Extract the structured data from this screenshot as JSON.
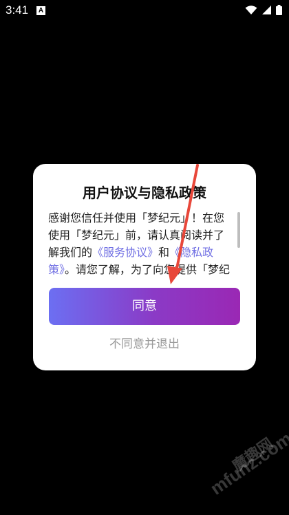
{
  "status_bar": {
    "time": "3:41",
    "notification_icon": "A"
  },
  "dialog": {
    "title": "用户协议与隐私政策",
    "body": {
      "part1": "感谢您信任并使用「梦纪元」！在您使用「梦纪元」前，请认真阅读并了解我们的",
      "service_link": "《服务协议》",
      "and": "和",
      "privacy_link": "《隐私政策》",
      "part2": "。请您了解，为了向您提供「梦纪元」"
    },
    "agree_label": "同意",
    "disagree_label": "不同意并退出"
  },
  "watermark": {
    "cn": "魔趣网",
    "en": "mfunz.com"
  },
  "colors": {
    "link": "#6f6ee3",
    "button_start": "#6c6ff2",
    "button_end": "#9a28b4",
    "arrow": "#e8473a"
  }
}
